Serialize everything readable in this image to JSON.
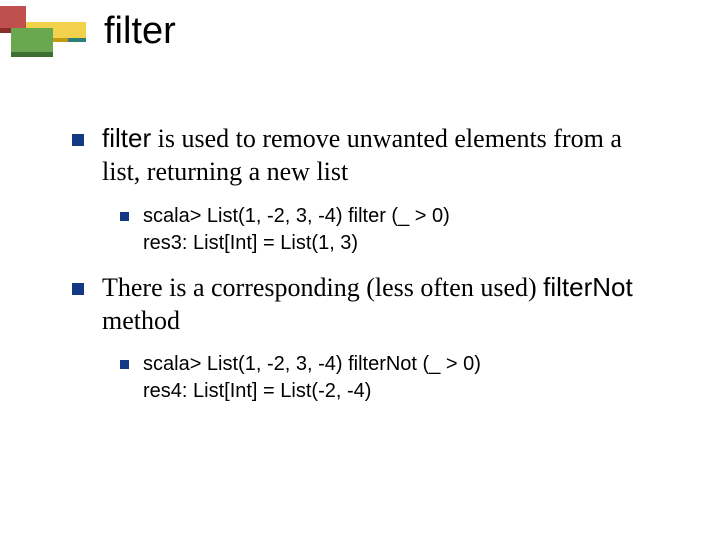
{
  "title": "filter",
  "items": [
    {
      "segments": [
        {
          "text": "filter",
          "mono": true
        },
        {
          "text": " is used to remove unwanted elements from a list, returning a new list",
          "mono": false
        }
      ],
      "children": [
        {
          "lines": [
            "scala> List(1, -2, 3, -4) filter (_ > 0)",
            "res3: List[Int] = List(1, 3)"
          ]
        }
      ]
    },
    {
      "segments": [
        {
          "text": "There is a corresponding (less often used) ",
          "mono": false
        },
        {
          "text": "filterNot",
          "mono": true
        },
        {
          "text": " method",
          "mono": false
        }
      ],
      "children": [
        {
          "lines": [
            "scala> List(1, -2, 3, -4) filterNot (_ > 0)",
            "res4: List[Int] = List(-2, -4)"
          ]
        }
      ]
    }
  ],
  "colors": {
    "bullet": "#133984",
    "logo_red": "#c0504d",
    "logo_dark_red": "#8a2e2a",
    "logo_yellow": "#f2d24d",
    "logo_green": "#6aa84f",
    "logo_dark_green": "#3e6e32",
    "logo_teal": "#2e7d78"
  }
}
